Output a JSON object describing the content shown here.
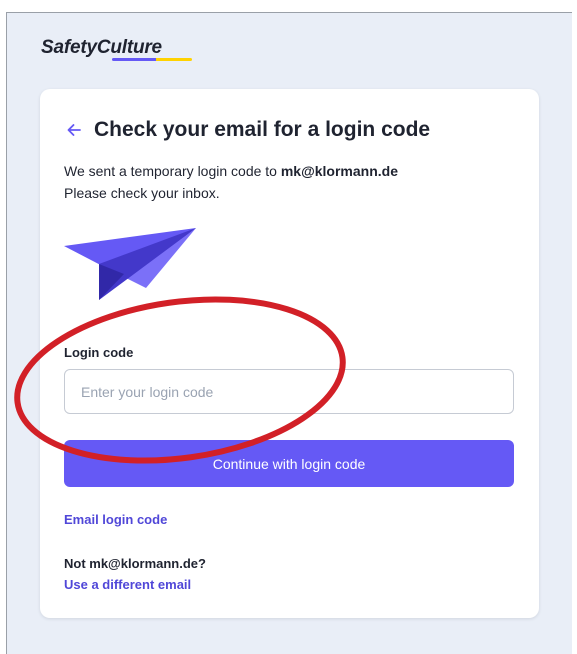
{
  "brand": {
    "logo_text": "SafetyCulture",
    "colors": {
      "primary": "#6559f5",
      "accent": "#ffd200"
    }
  },
  "card": {
    "title": "Check your email for a login code",
    "back_icon": "arrow-left-icon",
    "description": {
      "line1_prefix": "We sent a temporary login code to ",
      "email": "mk@klormann.de",
      "line2": "Please check your inbox."
    },
    "illustration": "paper-plane-icon",
    "login_code": {
      "label": "Login code",
      "placeholder": "Enter your login code",
      "value": ""
    },
    "continue_button": "Continue with login code",
    "email_login_code_link": "Email login code",
    "not_user_text": "Not mk@klormann.de?",
    "different_email_link": "Use a different email"
  },
  "annotation": {
    "shape": "ellipse",
    "color": "#d22027"
  }
}
